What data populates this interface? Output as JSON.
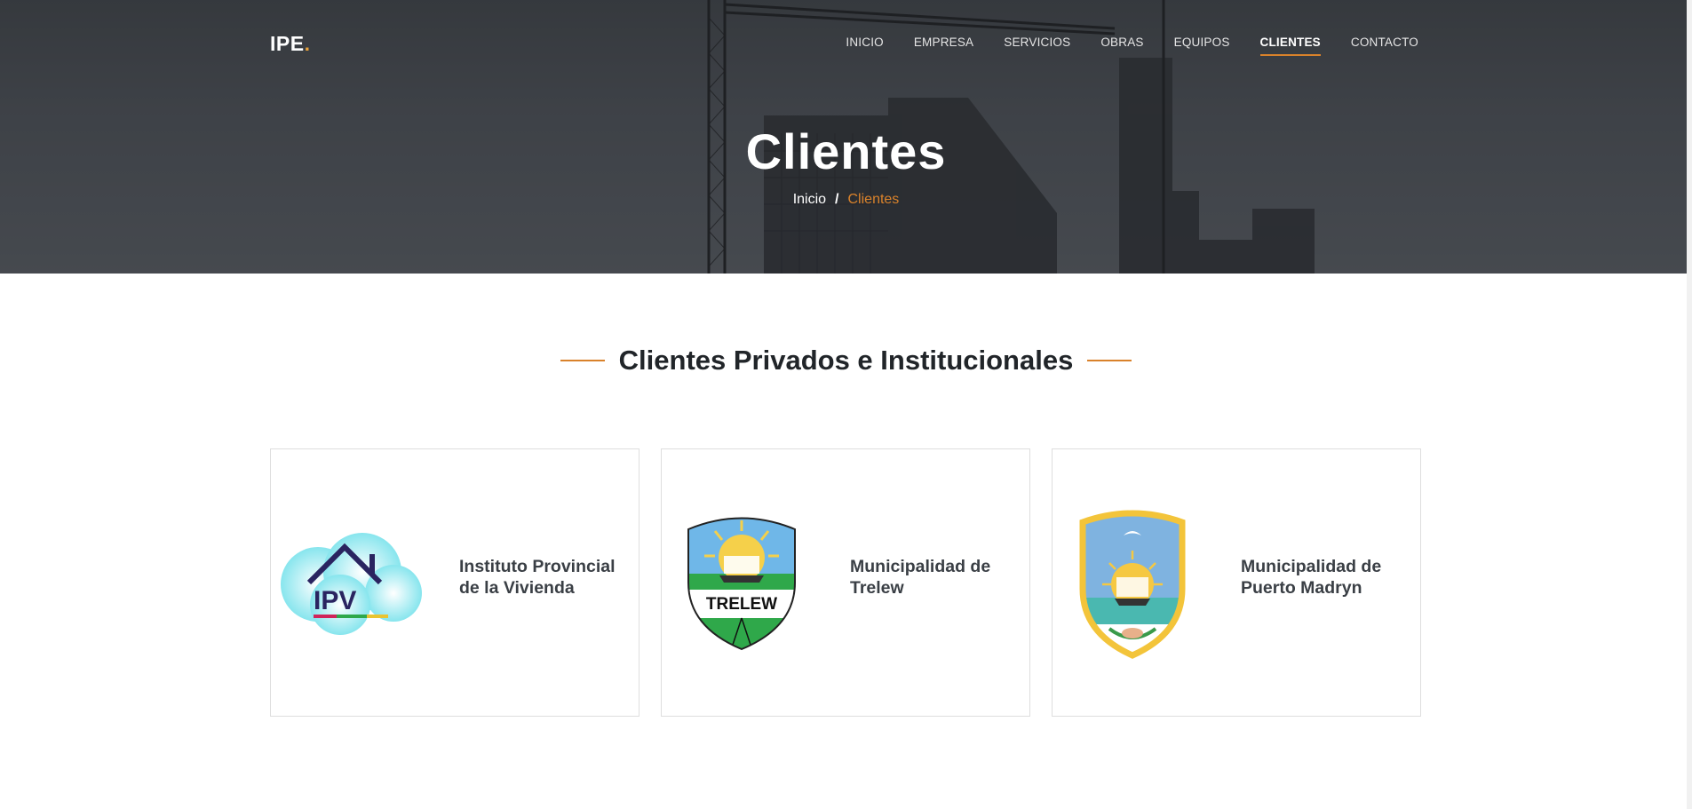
{
  "header": {
    "logo_text": "IPE",
    "logo_dot": ".",
    "nav": [
      {
        "label": "INICIO",
        "active": false
      },
      {
        "label": "EMPRESA",
        "active": false
      },
      {
        "label": "SERVICIOS",
        "active": false
      },
      {
        "label": "OBRAS",
        "active": false
      },
      {
        "label": "EQUIPOS",
        "active": false
      },
      {
        "label": "CLIENTES",
        "active": true
      },
      {
        "label": "CONTACTO",
        "active": false
      }
    ]
  },
  "hero": {
    "title": "Clientes",
    "breadcrumb": {
      "home": "Inicio",
      "separator": "/",
      "current": "Clientes"
    }
  },
  "section": {
    "title": "Clientes Privados e Institucionales"
  },
  "clients": [
    {
      "name": "Instituto Provincial de la Vivienda",
      "logo_icon": "ipv-logo-icon",
      "logo_text": "IPV"
    },
    {
      "name": "Municipalidad de Trelew",
      "logo_icon": "trelew-shield-icon",
      "logo_text": "TRELEW"
    },
    {
      "name": "Municipalidad de Puerto Madryn",
      "logo_icon": "puerto-madryn-shield-icon"
    }
  ],
  "colors": {
    "accent": "#d9822b",
    "logo_dot": "#e8a13a",
    "heading": "#212529",
    "card_text": "#3a3f45"
  }
}
